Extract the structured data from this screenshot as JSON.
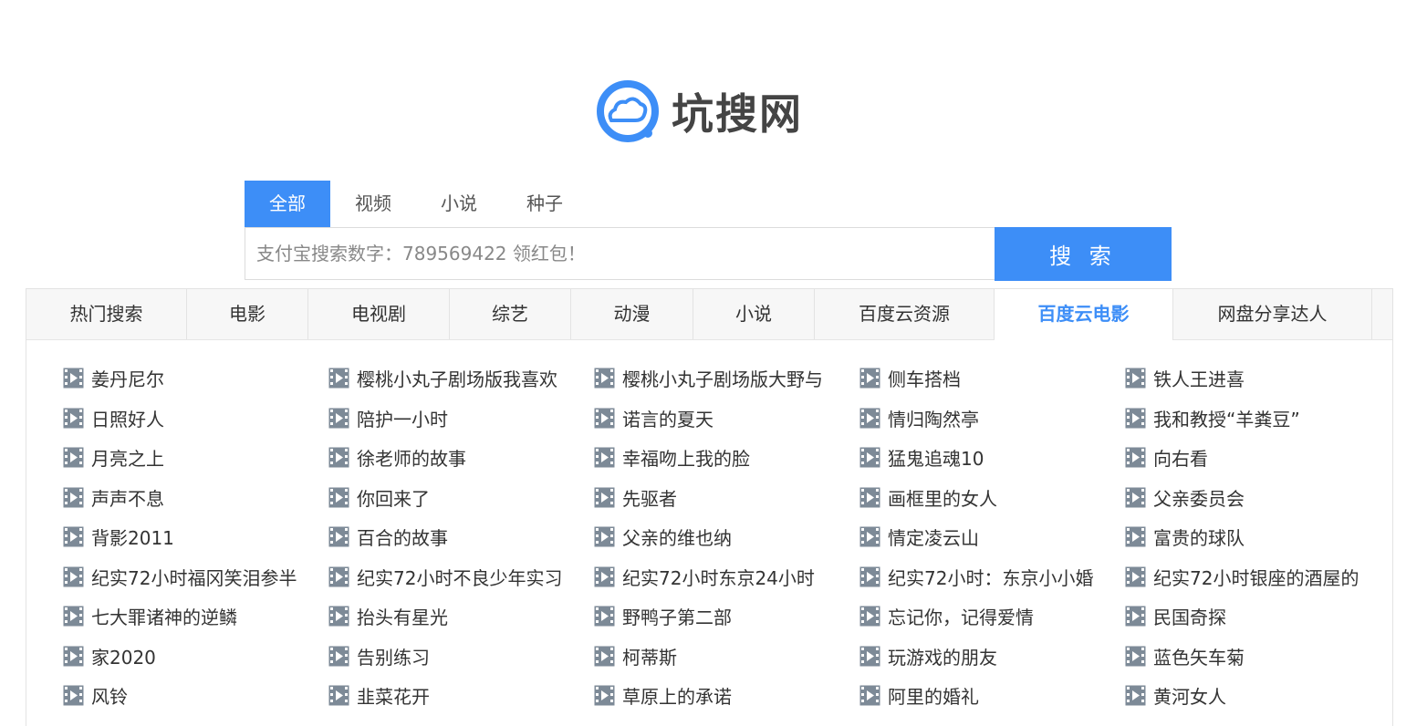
{
  "logo": {
    "text": "坑搜网"
  },
  "search": {
    "tabs": [
      "全部",
      "视频",
      "小说",
      "种子"
    ],
    "active_tab": 0,
    "placeholder": "支付宝搜索数字：789569422 领红包！",
    "button_label": "搜 索"
  },
  "categories": {
    "tabs": [
      "热门搜索",
      "电影",
      "电视剧",
      "综艺",
      "动漫",
      "小说",
      "百度云资源",
      "百度云电影",
      "网盘分享达人"
    ],
    "active": 7
  },
  "colors": {
    "accent": "#3d8ef7",
    "icon_gray": "#7d8a97"
  },
  "icons": {
    "logo": "cloud-logo-icon",
    "item": "video-play-icon"
  },
  "items": [
    [
      "姜丹尼尔",
      "樱桃小丸子剧场版我喜欢",
      "樱桃小丸子剧场版大野与",
      "侧车搭档",
      "铁人王进喜"
    ],
    [
      "日照好人",
      "陪护一小时",
      "诺言的夏天",
      "情归陶然亭",
      "我和教授“羊粪豆”"
    ],
    [
      "月亮之上",
      "徐老师的故事",
      "幸福吻上我的脸",
      "猛鬼追魂10",
      "向右看"
    ],
    [
      "声声不息",
      "你回来了",
      "先驱者",
      "画框里的女人",
      "父亲委员会"
    ],
    [
      "背影2011",
      "百合的故事",
      "父亲的维也纳",
      "情定凌云山",
      "富贵的球队"
    ],
    [
      "纪实72小时福冈笑泪参半",
      "纪实72小时不良少年实习",
      "纪实72小时东京24小时",
      "纪实72小时：东京小小婚",
      "纪实72小时银座的酒屋的"
    ],
    [
      "七大罪诸神的逆鳞",
      "抬头有星光",
      "野鸭子第二部",
      "忘记你，记得爱情",
      "民国奇探"
    ],
    [
      "家2020",
      "告别练习",
      "柯蒂斯",
      "玩游戏的朋友",
      "蓝色矢车菊"
    ],
    [
      "风铃",
      "韭菜花开",
      "草原上的承诺",
      "阿里的婚礼",
      "黄河女人"
    ]
  ]
}
